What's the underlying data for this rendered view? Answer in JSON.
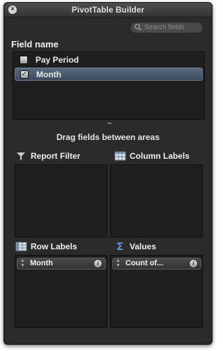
{
  "window": {
    "title": "PivotTable Builder"
  },
  "search": {
    "placeholder": "Search fields"
  },
  "fields": {
    "heading": "Field name",
    "items": [
      {
        "label": "Pay Period",
        "checked": false,
        "selected": false
      },
      {
        "label": "Month",
        "checked": true,
        "selected": true
      }
    ]
  },
  "instruction": "Drag fields between areas",
  "areas": {
    "report_filter": {
      "label": "Report Filter",
      "icon": "filter-icon"
    },
    "column_labels": {
      "label": "Column Labels",
      "icon": "column-labels-icon"
    },
    "row_labels": {
      "label": "Row Labels",
      "icon": "row-labels-icon",
      "pill": "Month"
    },
    "values": {
      "label": "Values",
      "icon": "sigma-icon",
      "pill": "Count of..."
    }
  },
  "colors": {
    "background": "#2a2a2a",
    "selection": "#4b5a6e",
    "text": "#f0f0f0"
  }
}
